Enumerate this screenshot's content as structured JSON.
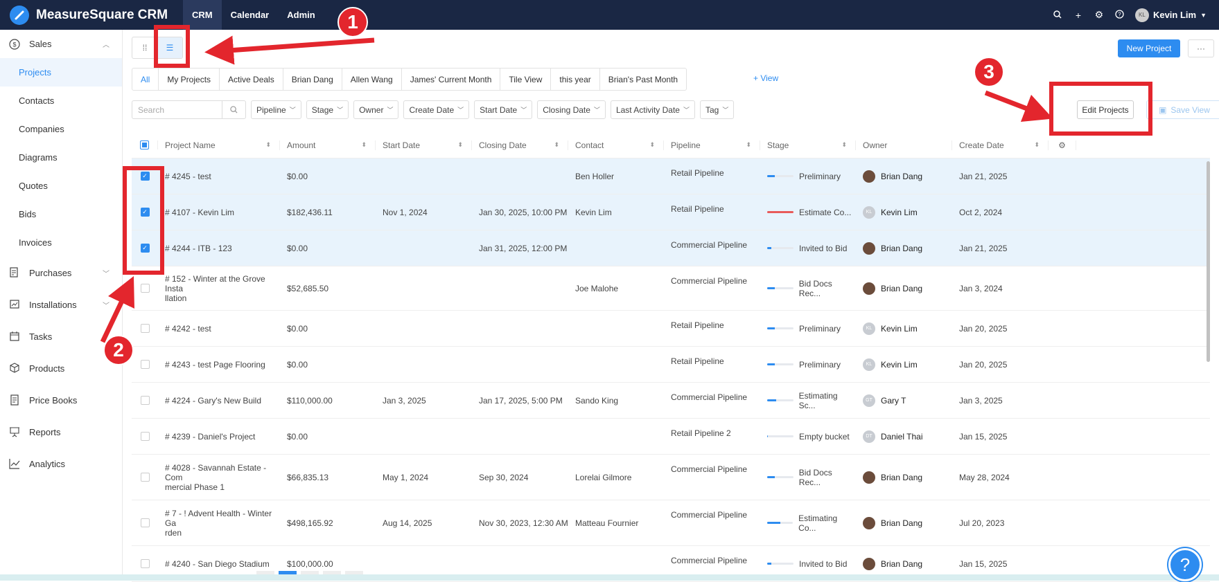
{
  "app": {
    "title": "MeasureSquare CRM",
    "logo_icon": "ruler-logo-icon"
  },
  "topnav": [
    {
      "label": "CRM",
      "active": true
    },
    {
      "label": "Calendar"
    },
    {
      "label": "Admin"
    }
  ],
  "topbar_right": {
    "user_initials": "KL",
    "user_name": "Kevin Lim"
  },
  "sidebar": {
    "sales": {
      "label": "Sales"
    },
    "sales_items": [
      "Projects",
      "Contacts",
      "Companies",
      "Diagrams",
      "Quotes",
      "Bids",
      "Invoices"
    ],
    "purchases": "Purchases",
    "installations": "Installations",
    "tasks": "Tasks",
    "products": "Products",
    "pricebooks": "Price Books",
    "reports": "Reports",
    "analytics": "Analytics"
  },
  "toolbar": {
    "new_project": "New Project",
    "more": "···",
    "edit_projects": "Edit Projects",
    "save_view": "Save View"
  },
  "tabs": [
    "All",
    "My Projects",
    "Active Deals",
    "Brian Dang",
    "Allen Wang",
    "James' Current Month",
    "Tile View",
    "this year",
    "Brian's Past Month"
  ],
  "add_view": "+ View",
  "search": {
    "placeholder": "Search"
  },
  "filters": [
    "Pipeline",
    "Stage",
    "Owner",
    "Create Date",
    "Start Date",
    "Closing Date",
    "Last Activity Date",
    "Tag"
  ],
  "columns": [
    "Project Name",
    "Amount",
    "Start Date",
    "Closing Date",
    "Contact",
    "Pipeline",
    "Stage",
    "Owner",
    "Create Date"
  ],
  "rows": [
    {
      "selected": true,
      "name1": "# 4245 - test",
      "name2": "",
      "amount": "$0.00",
      "start": "",
      "closing": "",
      "contact": "Ben Holler",
      "pipeline": "Retail Pipeline",
      "stage": "Preliminary",
      "progress": 0.3,
      "owner": "Brian Dang",
      "owner_initials": "",
      "created": "Jan 21, 2025"
    },
    {
      "selected": true,
      "name1": "# 4107 - Kevin Lim",
      "name2": "",
      "amount": "$182,436.11",
      "start": "Nov 1, 2024",
      "closing": "Jan 30, 2025, 10:00 PM",
      "contact": "Kevin Lim",
      "pipeline": "Retail Pipeline",
      "stage": "Estimate Co...",
      "progress": 1.0,
      "bar_color": "#e85a5a",
      "owner": "Kevin Lim",
      "owner_initials": "KL",
      "created": "Oct 2, 2024"
    },
    {
      "selected": true,
      "name1": "# 4244 - ITB - 123",
      "name2": "",
      "amount": "$0.00",
      "start": "",
      "closing": "Jan 31, 2025, 12:00 PM",
      "contact": "",
      "pipeline": "Commercial Pipeline",
      "stage": "Invited to Bid",
      "progress": 0.15,
      "owner": "Brian Dang",
      "owner_initials": "",
      "created": "Jan 21, 2025"
    },
    {
      "selected": false,
      "name1": "# 152 - Winter at the Grove Insta",
      "name2": "llation",
      "amount": "$52,685.50",
      "start": "",
      "closing": "",
      "contact": "Joe Malohe",
      "pipeline": "Commercial Pipeline",
      "stage": "Bid Docs Rec...",
      "progress": 0.3,
      "owner": "Brian Dang",
      "owner_initials": "",
      "created": "Jan 3, 2024"
    },
    {
      "selected": false,
      "name1": "# 4242 - test",
      "name2": "",
      "amount": "$0.00",
      "start": "",
      "closing": "",
      "contact": "",
      "pipeline": "Retail Pipeline",
      "stage": "Preliminary",
      "progress": 0.3,
      "owner": "Kevin Lim",
      "owner_initials": "KL",
      "created": "Jan 20, 2025"
    },
    {
      "selected": false,
      "name1": "# 4243 - test Page Flooring",
      "name2": "",
      "amount": "$0.00",
      "start": "",
      "closing": "",
      "contact": "",
      "pipeline": "Retail Pipeline",
      "stage": "Preliminary",
      "progress": 0.3,
      "owner": "Kevin Lim",
      "owner_initials": "KL",
      "created": "Jan 20, 2025"
    },
    {
      "selected": false,
      "name1": "# 4224 - Gary's New Build",
      "name2": "",
      "amount": "$110,000.00",
      "start": "Jan 3, 2025",
      "closing": "Jan 17, 2025, 5:00 PM",
      "contact": "Sando King",
      "pipeline": "Commercial Pipeline",
      "stage": "Estimating Sc...",
      "progress": 0.35,
      "owner": "Gary T",
      "owner_initials": "GT",
      "created": "Jan 3, 2025"
    },
    {
      "selected": false,
      "name1": "# 4239 - Daniel's Project",
      "name2": "",
      "amount": "$0.00",
      "start": "",
      "closing": "",
      "contact": "",
      "pipeline": "Retail Pipeline 2",
      "stage": "Empty bucket",
      "progress": 0.03,
      "owner": "Daniel Thai",
      "owner_initials": "DT",
      "created": "Jan 15, 2025"
    },
    {
      "selected": false,
      "name1": "# 4028 - Savannah Estate - Com",
      "name2": "mercial Phase 1",
      "amount": "$66,835.13",
      "start": "May 1, 2024",
      "closing": "Sep 30, 2024",
      "contact": "Lorelai Gilmore",
      "pipeline": "Commercial Pipeline",
      "stage": "Bid Docs Rec...",
      "progress": 0.3,
      "owner": "Brian Dang",
      "owner_initials": "",
      "created": "May 28, 2024"
    },
    {
      "selected": false,
      "name1": "# 7 - ! Advent Health - Winter Ga",
      "name2": "rden",
      "amount": "$498,165.92",
      "start": "Aug 14, 2025",
      "closing": "Nov 30, 2023, 12:30 AM",
      "contact": "Matteau Fournier",
      "pipeline": "Commercial Pipeline",
      "stage": "Estimating Co...",
      "progress": 0.5,
      "owner": "Brian Dang",
      "owner_initials": "",
      "created": "Jul 20, 2023"
    },
    {
      "selected": false,
      "name1": "# 4240 - San Diego Stadium",
      "name2": "",
      "amount": "$100,000.00",
      "start": "",
      "closing": "",
      "contact": "",
      "pipeline": "Commercial Pipeline",
      "stage": "Invited to Bid",
      "progress": 0.15,
      "owner": "Brian Dang",
      "owner_initials": "",
      "created": "Jan 15, 2025"
    }
  ],
  "annotations": {
    "badge1": "1",
    "badge2": "2",
    "badge3": "3",
    "color": "#e3262d"
  }
}
